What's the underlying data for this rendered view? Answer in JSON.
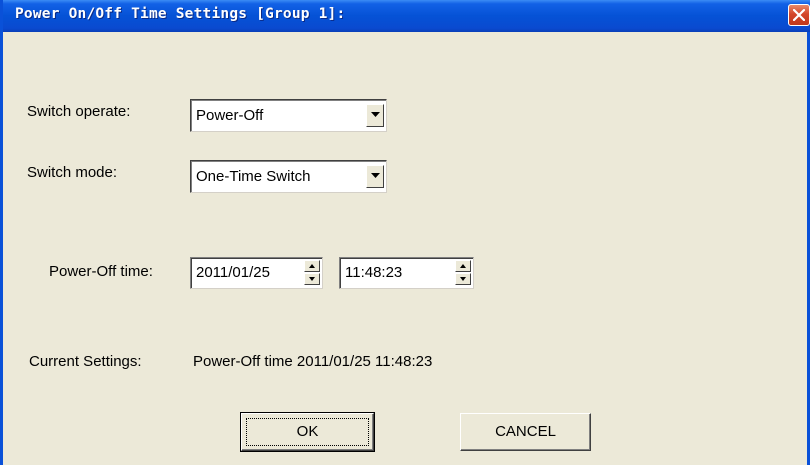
{
  "window": {
    "title": "Power On/Off Time Settings [Group 1]:"
  },
  "form": {
    "switch_operate": {
      "label": "Switch operate:",
      "value": "Power-Off"
    },
    "switch_mode": {
      "label": "Switch  mode:",
      "value": "One-Time Switch"
    },
    "power_off_time": {
      "label": "Power-Off time:",
      "date": "2011/01/25",
      "time": "11:48:23"
    },
    "current_settings": {
      "label": "Current Settings:",
      "value": "Power-Off time 2011/01/25 11:48:23"
    }
  },
  "buttons": {
    "ok": "OK",
    "cancel": "CANCEL"
  },
  "colors": {
    "titlebar": "#0a4ad0",
    "dialog_bg": "#ece9d8",
    "close_button": "#d4462a"
  }
}
